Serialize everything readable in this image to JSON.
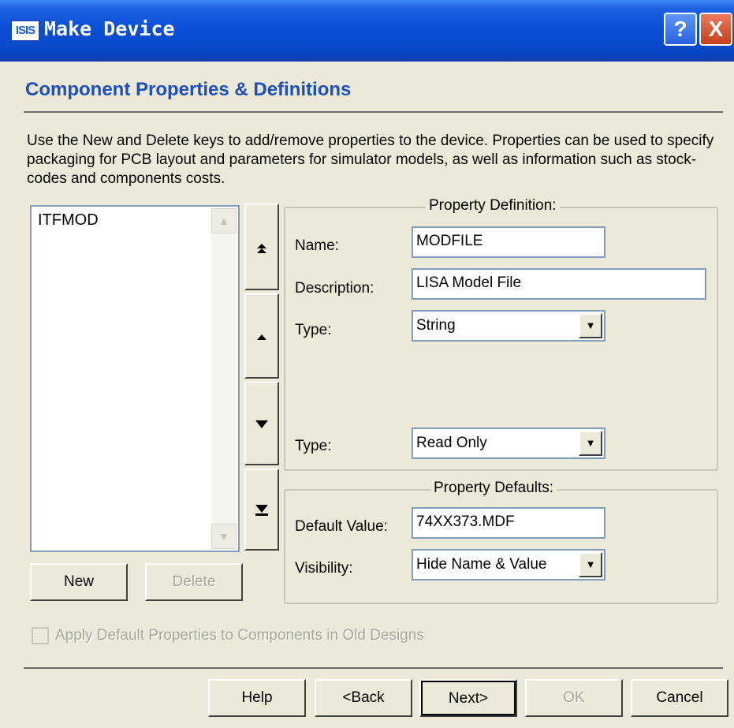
{
  "window": {
    "app_icon_text": "ISIS",
    "title": "Make Device"
  },
  "titlebar_buttons": {
    "help": "?",
    "close": "X"
  },
  "page": {
    "heading": "Component Properties & Definitions",
    "description": "Use the New and Delete keys to add/remove properties to the device. Properties can be used to specify packaging for PCB layout and parameters for simulator models, as well as information such as stock-codes and components costs."
  },
  "property_list": {
    "items": [
      "ITFMOD"
    ]
  },
  "list_buttons": {
    "new": "New",
    "delete": "Delete"
  },
  "property_definition": {
    "title": "Property Definition:",
    "name_label": "Name:",
    "name_value": "MODFILE",
    "description_label": "Description:",
    "description_value": "LISA Model File",
    "type_label": "Type:",
    "type_value": "String",
    "type2_label": "Type:",
    "type2_value": "Read Only"
  },
  "property_defaults": {
    "title": "Property Defaults:",
    "default_value_label": "Default Value:",
    "default_value": "74XX373.MDF",
    "visibility_label": "Visibility:",
    "visibility_value": "Hide Name & Value"
  },
  "apply_checkbox": {
    "label": "Apply Default Properties to Components in Old Designs",
    "checked": false,
    "enabled": false
  },
  "footer_buttons": {
    "help": "Help",
    "back": "<Back",
    "next": "Next>",
    "ok": "OK",
    "cancel": "Cancel"
  },
  "icons": {
    "move_top": "double-up-arrow-icon",
    "move_up": "up-arrow-icon",
    "move_down": "down-arrow-icon",
    "move_bottom": "down-to-bar-icon"
  }
}
